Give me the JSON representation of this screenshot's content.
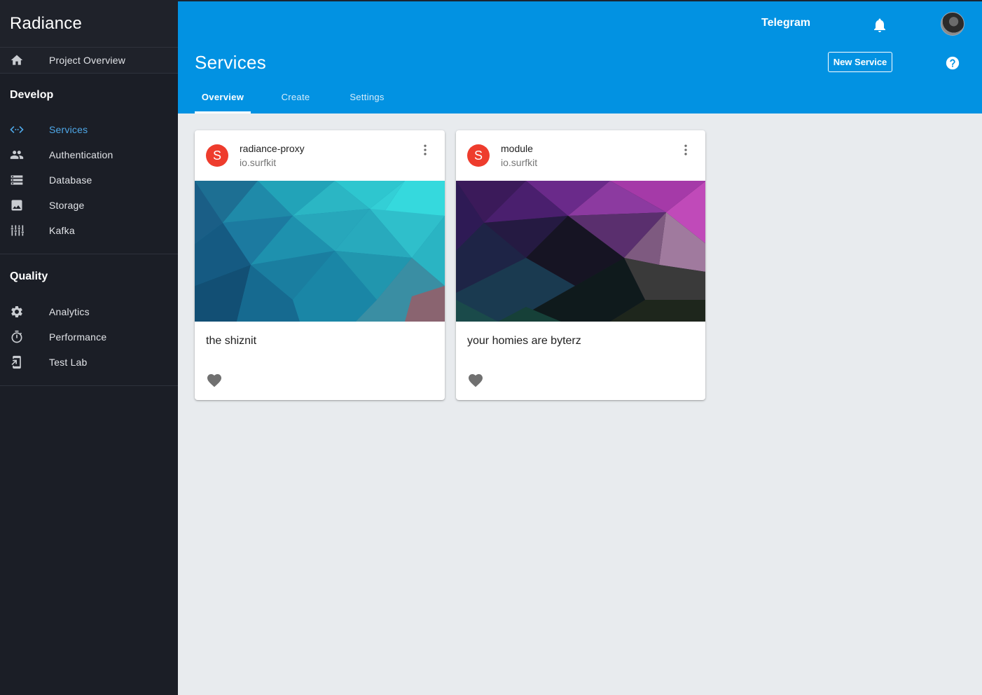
{
  "app": {
    "brand": "Radiance"
  },
  "sidebar": {
    "overview": {
      "label": "Project Overview",
      "icon": "home-icon"
    },
    "sections": [
      {
        "title": "Develop",
        "items": [
          {
            "label": "Services",
            "icon": "code-icon",
            "active": true
          },
          {
            "label": "Authentication",
            "icon": "people-icon"
          },
          {
            "label": "Database",
            "icon": "storage-icon"
          },
          {
            "label": "Storage",
            "icon": "image-icon"
          },
          {
            "label": "Kafka",
            "icon": "equalizer-icon"
          }
        ]
      },
      {
        "title": "Quality",
        "items": [
          {
            "label": "Analytics",
            "icon": "gear-icon"
          },
          {
            "label": "Performance",
            "icon": "timer-icon"
          },
          {
            "label": "Test Lab",
            "icon": "device-icon"
          }
        ]
      }
    ]
  },
  "header": {
    "project": "Telegram",
    "title": "Services",
    "new_service_label": "New Service",
    "tabs": [
      {
        "label": "Overview",
        "active": true
      },
      {
        "label": "Create"
      },
      {
        "label": "Settings"
      }
    ],
    "accent": "#0292e2"
  },
  "cards": [
    {
      "avatar_letter": "S",
      "title": "radiance-proxy",
      "subtitle": "io.surfkit",
      "text": "the shiznit",
      "theme": "teal"
    },
    {
      "avatar_letter": "S",
      "title": "module",
      "subtitle": "io.surfkit",
      "text": "your homies are byterz",
      "theme": "purple"
    }
  ],
  "colors": {
    "sidebar_bg": "#1b1e26",
    "active_nav": "#4fa8e8",
    "avatar_red": "#ee3c2d",
    "content_bg": "#e8ebee"
  }
}
